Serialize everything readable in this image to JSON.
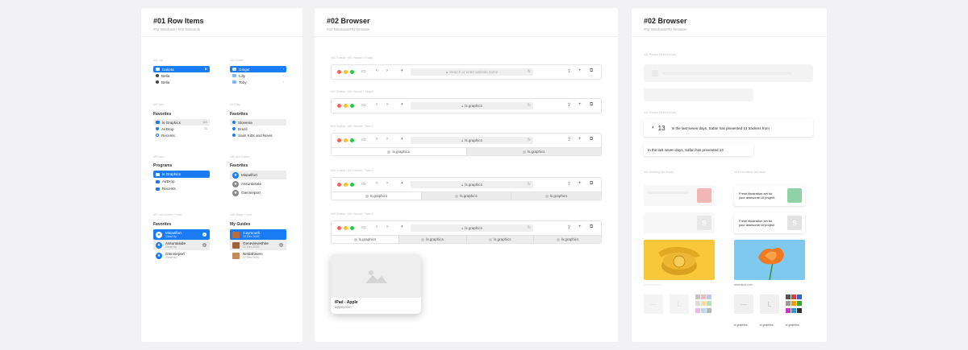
{
  "panel1": {
    "title": "#01 Row Items",
    "subtitle": "#02 Windows / #06 Elements",
    "g1": {
      "caption_a": "#01 List",
      "a": [
        {
          "label": "Dakota",
          "right": "⌘"
        },
        {
          "label": "Bella",
          "right": ""
        },
        {
          "label": "Bella",
          "right": ""
        }
      ],
      "caption_b": "#02 Folder",
      "b": [
        {
          "label": "Ginger",
          "right": "›"
        },
        {
          "label": "Lilly",
          "right": "›"
        },
        {
          "label": "Toby",
          "right": "›"
        }
      ]
    },
    "g2": {
      "caption_a": "#03 Icon",
      "a_header": "Favorites",
      "a": [
        {
          "label": "ls Graphics",
          "right": "123"
        },
        {
          "label": "AirDrop",
          "right": "11"
        },
        {
          "label": "Recents",
          "right": ""
        }
      ],
      "caption_b": "#04 Tag",
      "b_header": "Favorites",
      "b": [
        {
          "label": "Slovenia"
        },
        {
          "label": "Brazil"
        },
        {
          "label": "Saint Kitts and Nevis"
        }
      ]
    },
    "g3": {
      "caption_a": "#05 Icon",
      "a_header": "Programs",
      "a": [
        {
          "label": "ls Graphics"
        },
        {
          "label": "AirDrop"
        },
        {
          "label": "Recents"
        }
      ],
      "caption_b": "#06 Icon Button",
      "b_header": "Favorites",
      "b": [
        {
          "label": "Misaelfurt"
        },
        {
          "label": "Assuntaside"
        },
        {
          "label": "Glennieport"
        }
      ]
    },
    "g4": {
      "caption_a": "#07 Icon Button + Line",
      "a_header": "Favorites",
      "a": [
        {
          "title": "Misaelfurt",
          "sub": "Close by"
        },
        {
          "title": "Assuntaside",
          "sub": "Close by"
        },
        {
          "title": "Glennieport",
          "sub": "Close by"
        }
      ],
      "caption_b": "#08 Image + Line",
      "b_header": "My Guides",
      "b": [
        {
          "title": "Gaymouth",
          "sub": "12 Dec 2020"
        },
        {
          "title": "Genevieveshire",
          "sub": "21 Dec 2020"
        },
        {
          "title": "Neldahaven",
          "sub": "07 Dec 2020"
        }
      ]
    }
  },
  "panel2": {
    "title": "#02 Browser",
    "subtitle": "#02 Windows/#02 Browser",
    "bars": [
      {
        "caption": "#01 Toolbar / #01 Header / Empty",
        "address": "Search or enter website name",
        "placeholder": true,
        "tabs": []
      },
      {
        "caption": "#02 Toolbar / #01 Header / Simple",
        "address": "ls.graphics",
        "placeholder": false,
        "tabs": []
      },
      {
        "caption": "#03 Toolbar / #01 Header / Tabs 2",
        "address": "ls.graphics",
        "placeholder": false,
        "tabs": [
          "ls.graphics",
          "ls.graphics"
        ]
      },
      {
        "caption": "#04 Toolbar / #01 Header / Tabs 3",
        "address": "ls.graphics",
        "placeholder": false,
        "tabs": [
          "ls.graphics",
          "ls.graphics",
          "ls.graphics"
        ]
      },
      {
        "caption": "#05 Toolbar / #01 Header / Tabs 4",
        "address": "ls.graphics",
        "placeholder": false,
        "tabs": [
          "ls.graphics",
          "ls.graphics",
          "ls.graphics",
          "ls.graphics"
        ]
      }
    ],
    "preview": {
      "title": "iPad - Apple",
      "url": "apple.com"
    }
  },
  "panel3": {
    "title": "#02 Browser",
    "subtitle": "#02 Windows/#02 Browser",
    "cap1": "#01 Privacy Report empty",
    "cap2": "#02 Privacy Report empty",
    "tracker_count": "13",
    "tracker_text": "In the last seven days, Safari has prevented 13 trackers from",
    "tracker_text2": "In the last seven days, Safari has prevented 13",
    "cap3": "#03 Reading List empty",
    "cap4": "#04 Favorites/Card news",
    "fresh1": "Fresh illustration set for",
    "fresh2": "your awesome UI project",
    "caption_url": "adventure.com",
    "letter": "L",
    "s_letter": "S",
    "tile_label": "ls graphics",
    "colors": {
      "yellow": "#f8c83a",
      "sky": "#7fc8ee",
      "accent": "#1a7cf5"
    }
  }
}
